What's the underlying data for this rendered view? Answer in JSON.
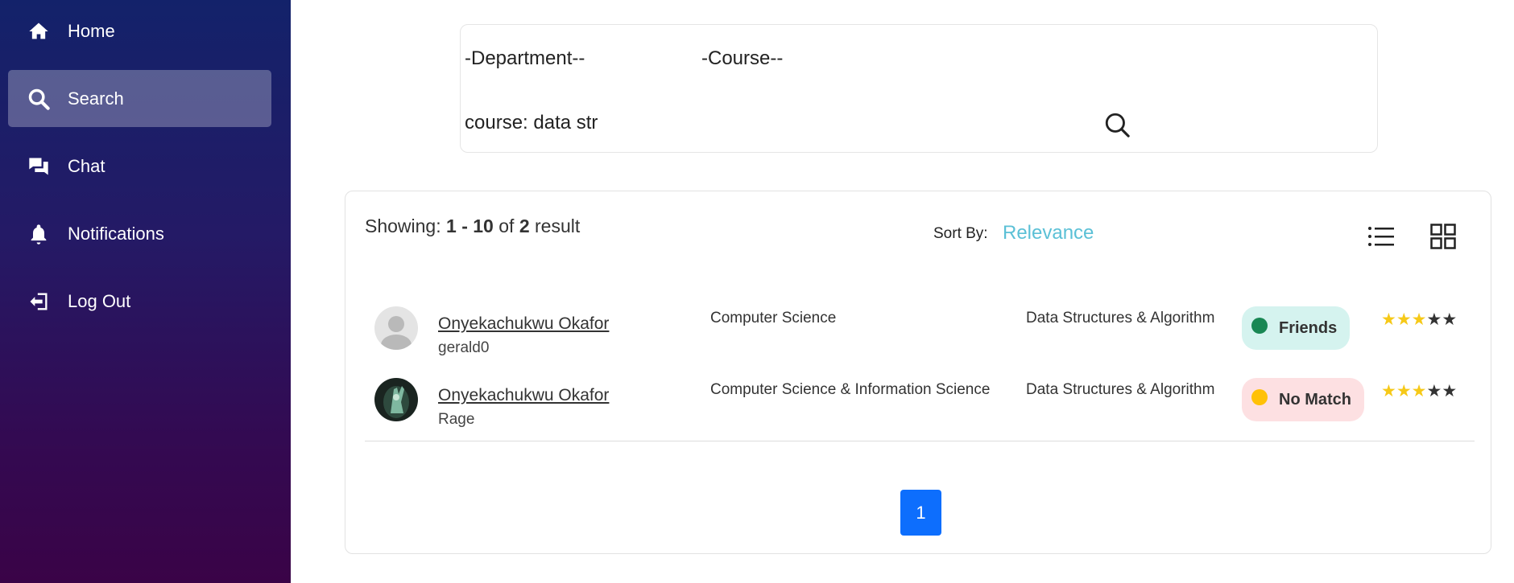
{
  "sidebar": {
    "items": [
      {
        "label": "Home",
        "icon": "home-icon"
      },
      {
        "label": "Search",
        "icon": "search-icon",
        "active": true
      },
      {
        "label": "Chat",
        "icon": "chat-icon"
      },
      {
        "label": "Notifications",
        "icon": "bell-icon"
      },
      {
        "label": "Log Out",
        "icon": "logout-icon"
      }
    ]
  },
  "search": {
    "department_label": "-Department--",
    "course_label": "-Course--",
    "query": "course: data str"
  },
  "results": {
    "showing_prefix": "Showing:",
    "range": "1 - 10",
    "of_text": "of",
    "count": "2",
    "result_text": "result",
    "sort_label": "Sort By:",
    "sort_value": "Relevance",
    "rows": [
      {
        "name": "Onyekachukwu Okafor",
        "username": "gerald0",
        "department": "Computer Science",
        "course": "Data Structures & Algorithm",
        "status": "Friends",
        "status_color": "#198754",
        "status_bg": "#d5f3ef",
        "rating": 3,
        "rating_max": 5
      },
      {
        "name": "Onyekachukwu Okafor",
        "username": "Rage",
        "department": "Computer Science & Information Science",
        "course": "Data Structures & Algorithm",
        "status": "No Match",
        "status_color": "#ffc107",
        "status_bg": "#fde0e2",
        "rating": 3,
        "rating_max": 5
      }
    ],
    "current_page": "1"
  },
  "colors": {
    "accent": "#5bc0d6",
    "primary": "#0d6efd",
    "star": "#f6c918"
  }
}
